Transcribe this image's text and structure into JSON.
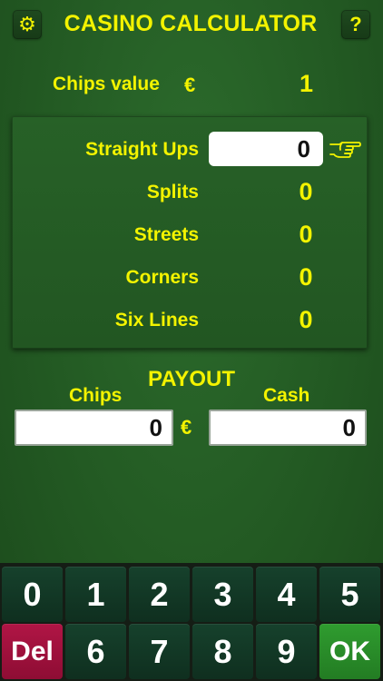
{
  "header": {
    "title": "CASINO CALCULATOR",
    "settings_icon": "⚙",
    "help_label": "?"
  },
  "chips_value": {
    "label": "Chips value",
    "currency": "€",
    "value": "1"
  },
  "bets": [
    {
      "label": "Straight Ups",
      "value": "0"
    },
    {
      "label": "Splits",
      "value": "0"
    },
    {
      "label": "Streets",
      "value": "0"
    },
    {
      "label": "Corners",
      "value": "0"
    },
    {
      "label": "Six Lines",
      "value": "0"
    }
  ],
  "pointer_icon": "pointing-hand-icon",
  "payout": {
    "title": "PAYOUT",
    "chips_label": "Chips",
    "cash_label": "Cash",
    "chips_value": "0",
    "currency": "€",
    "cash_value": "0"
  },
  "keypad": {
    "row1": [
      "0",
      "1",
      "2",
      "3",
      "4",
      "5"
    ],
    "row2": [
      "Del",
      "6",
      "7",
      "8",
      "9",
      "OK"
    ]
  },
  "colors": {
    "accent_yellow": "#f3f300",
    "felt_green": "#2c6b2c",
    "del_red": "#b01545",
    "ok_green": "#2f9c2f"
  }
}
